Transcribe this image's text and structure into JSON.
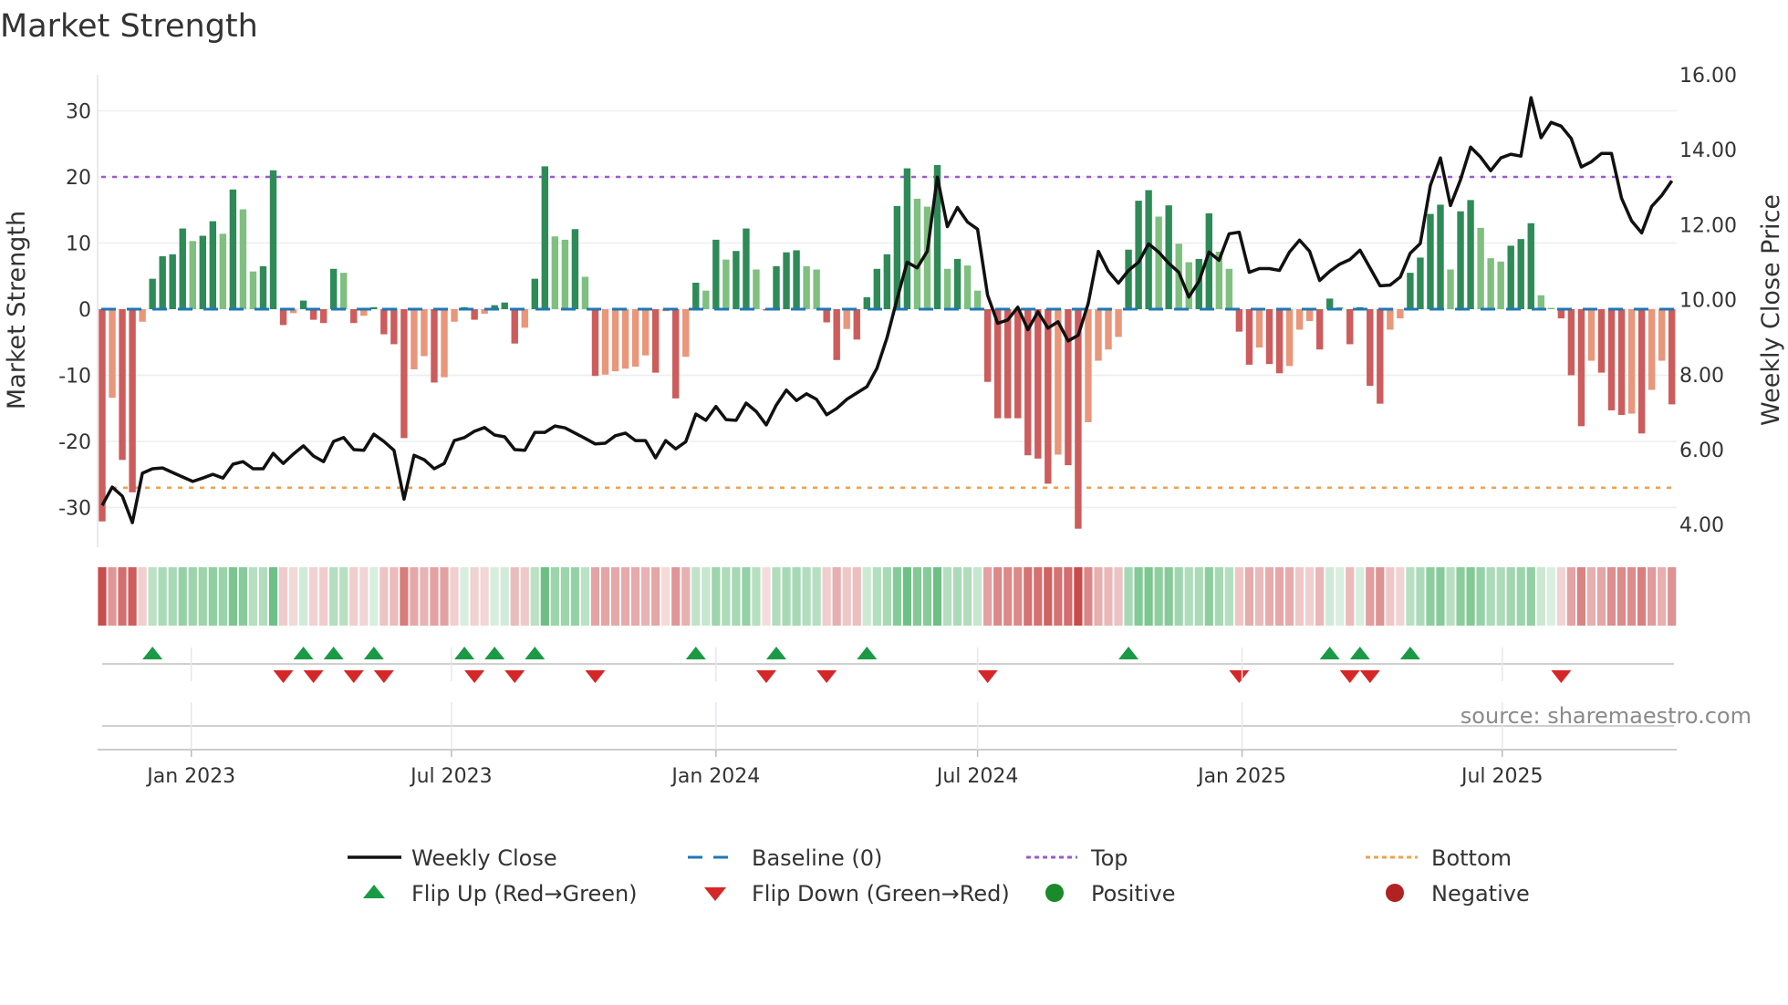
{
  "title": "Market Strength",
  "source": "source: sharemaestro.com",
  "colors": {
    "pos_strong": "#2e8b57",
    "pos_weak": "#7fbf7f",
    "neg_strong": "#cd5c5c",
    "neg_weak": "#e9967a",
    "price": "#111111",
    "baseline": "#1f77b4",
    "top": "#9b59d6",
    "bottom": "#f0a050",
    "flip_up": "#1a9a45",
    "flip_down": "#d62728",
    "grid": "#eeeeee"
  },
  "chart_data": {
    "type": "bar",
    "title": "Market Strength",
    "ylabel": "Market Strength",
    "y2label": "Weekly Close Price",
    "ylim": [
      -36,
      36
    ],
    "y2lim": [
      3.0,
      16.5
    ],
    "yticks": [
      30,
      20,
      10,
      0,
      -10,
      -20,
      -30
    ],
    "y2ticks": [
      "16.00",
      "14.00",
      "12.00",
      "10.00",
      "8.00",
      "6.00",
      "4.00"
    ],
    "x_start": "2022-10-31",
    "x_step_days": 7,
    "xticks": [
      {
        "date": "2023-01-01",
        "label": "Jan 2023"
      },
      {
        "date": "2023-07-01",
        "label": "Jul 2023"
      },
      {
        "date": "2024-01-01",
        "label": "Jan 2024"
      },
      {
        "date": "2024-07-01",
        "label": "Jul 2024"
      },
      {
        "date": "2025-01-01",
        "label": "Jan 2025"
      },
      {
        "date": "2025-07-01",
        "label": "Jul 2025"
      }
    ],
    "top_level": 20,
    "bottom_level": -27,
    "baseline": 0,
    "strength": [
      -32.1,
      -13.4,
      -22.8,
      -27.7,
      -1.9,
      4.6,
      8.0,
      8.3,
      12.2,
      10.3,
      11.1,
      13.3,
      11.4,
      18.1,
      15.1,
      5.7,
      6.5,
      21.0,
      -2.4,
      -0.6,
      1.3,
      -1.6,
      -2.1,
      6.1,
      5.5,
      -2.1,
      -1.0,
      0.3,
      -3.8,
      -5.3,
      -19.5,
      -9.1,
      -7.1,
      -11.1,
      -10.3,
      -1.9,
      0.3,
      -1.6,
      -0.7,
      0.6,
      1.0,
      -5.2,
      -2.8,
      4.6,
      21.6,
      11.0,
      10.5,
      12.1,
      4.9,
      -10.1,
      -9.9,
      -9.4,
      -9.0,
      -8.7,
      -7.0,
      -9.6,
      -0.3,
      -13.5,
      -7.2,
      4.0,
      2.8,
      10.5,
      7.5,
      8.8,
      12.2,
      6.0,
      -0.2,
      6.5,
      8.6,
      8.9,
      6.5,
      6.0,
      -2.0,
      -7.7,
      -3.0,
      -4.6,
      1.8,
      6.1,
      8.3,
      15.6,
      21.3,
      16.7,
      15.5,
      21.8,
      6.1,
      7.6,
      6.6,
      2.8,
      -11.0,
      -16.5,
      -16.5,
      -16.5,
      -22.1,
      -22.6,
      -26.4,
      -22.0,
      -23.6,
      -33.2,
      -17.1,
      -7.8,
      -6.1,
      -4.2,
      9.0,
      16.4,
      18.0,
      14.0,
      15.7,
      9.9,
      7.1,
      7.6,
      14.5,
      8.7,
      6.1,
      -3.4,
      -8.4,
      -5.8,
      -8.3,
      -9.7,
      -8.6,
      -3.1,
      -1.8,
      -6.1,
      1.6,
      0.3,
      -5.3,
      0.3,
      -11.6,
      -14.3,
      -3.1,
      -1.4,
      5.5,
      7.8,
      14.4,
      15.8,
      6.0,
      14.8,
      16.5,
      12.3,
      7.7,
      7.2,
      9.6,
      10.6,
      13.0,
      2.1,
      0.2,
      -1.4,
      -10.0,
      -17.7,
      -7.8,
      -9.6,
      -15.3,
      -16.0,
      -15.8,
      -18.8,
      -12.2,
      -7.8,
      -14.4
    ],
    "weekly_close": [
      4.51,
      5.0,
      4.76,
      4.05,
      5.37,
      5.49,
      5.51,
      5.39,
      5.27,
      5.15,
      5.24,
      5.34,
      5.24,
      5.61,
      5.68,
      5.49,
      5.49,
      5.9,
      5.63,
      5.88,
      6.1,
      5.83,
      5.68,
      6.22,
      6.32,
      6.0,
      5.98,
      6.41,
      6.22,
      5.98,
      4.68,
      5.85,
      5.73,
      5.49,
      5.63,
      6.24,
      6.32,
      6.49,
      6.59,
      6.39,
      6.34,
      6.0,
      5.98,
      6.46,
      6.46,
      6.63,
      6.58,
      6.44,
      6.3,
      6.15,
      6.17,
      6.37,
      6.44,
      6.24,
      6.24,
      5.78,
      6.24,
      6.02,
      6.21,
      6.95,
      6.78,
      7.15,
      6.8,
      6.78,
      7.24,
      7.02,
      6.66,
      7.19,
      7.59,
      7.31,
      7.49,
      7.34,
      6.93,
      7.1,
      7.34,
      7.51,
      7.68,
      8.17,
      8.98,
      10.02,
      11.0,
      10.85,
      11.29,
      13.27,
      11.95,
      12.46,
      12.07,
      11.88,
      10.12,
      9.37,
      9.46,
      9.8,
      9.2,
      9.68,
      9.24,
      9.41,
      8.9,
      9.05,
      9.9,
      11.29,
      10.76,
      10.44,
      10.78,
      11.0,
      11.49,
      11.27,
      10.97,
      10.73,
      10.07,
      10.49,
      11.27,
      11.05,
      11.76,
      11.8,
      10.73,
      10.83,
      10.83,
      10.78,
      11.27,
      11.59,
      11.29,
      10.51,
      10.76,
      10.95,
      11.07,
      11.32,
      10.85,
      10.37,
      10.39,
      10.6,
      11.24,
      11.5,
      13.05,
      13.78,
      12.51,
      13.2,
      14.07,
      13.8,
      13.44,
      13.78,
      13.88,
      13.83,
      15.39,
      14.32,
      14.73,
      14.63,
      14.3,
      13.54,
      13.68,
      13.9,
      13.9,
      12.71,
      12.1,
      11.78,
      12.49,
      12.78,
      13.17
    ],
    "flip_up_weeks": [
      5,
      20,
      23,
      27,
      36,
      39,
      43,
      59,
      67,
      76,
      102,
      122,
      125,
      130
    ],
    "flip_down_weeks": [
      18,
      21,
      25,
      28,
      37,
      41,
      49,
      66,
      72,
      88,
      113,
      124,
      126,
      145
    ],
    "legend": {
      "placement": "bottom",
      "entries": [
        "Weekly Close",
        "Baseline (0)",
        "Top",
        "Bottom",
        "Flip Up (Red→Green)",
        "Flip Down (Green→Red)",
        "Positive",
        "Negative"
      ]
    }
  }
}
